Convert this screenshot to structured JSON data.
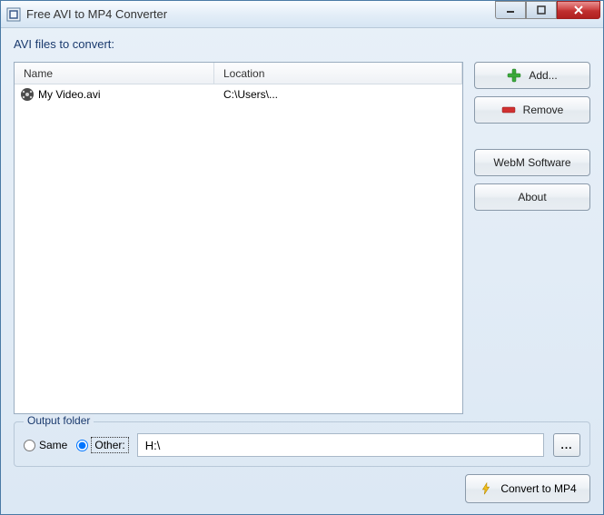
{
  "window": {
    "title": "Free AVI to MP4 Converter"
  },
  "section": {
    "files_label": "AVI files to convert:"
  },
  "columns": {
    "name": "Name",
    "location": "Location"
  },
  "files": [
    {
      "name": "My Video.avi",
      "location": "C:\\Users\\..."
    }
  ],
  "buttons": {
    "add": "Add...",
    "remove": "Remove",
    "webm": "WebM Software",
    "about": "About",
    "browse": "...",
    "convert": "Convert to MP4"
  },
  "output": {
    "group_label": "Output folder",
    "same_label": "Same",
    "other_label": "Other:",
    "path": "H:\\"
  }
}
